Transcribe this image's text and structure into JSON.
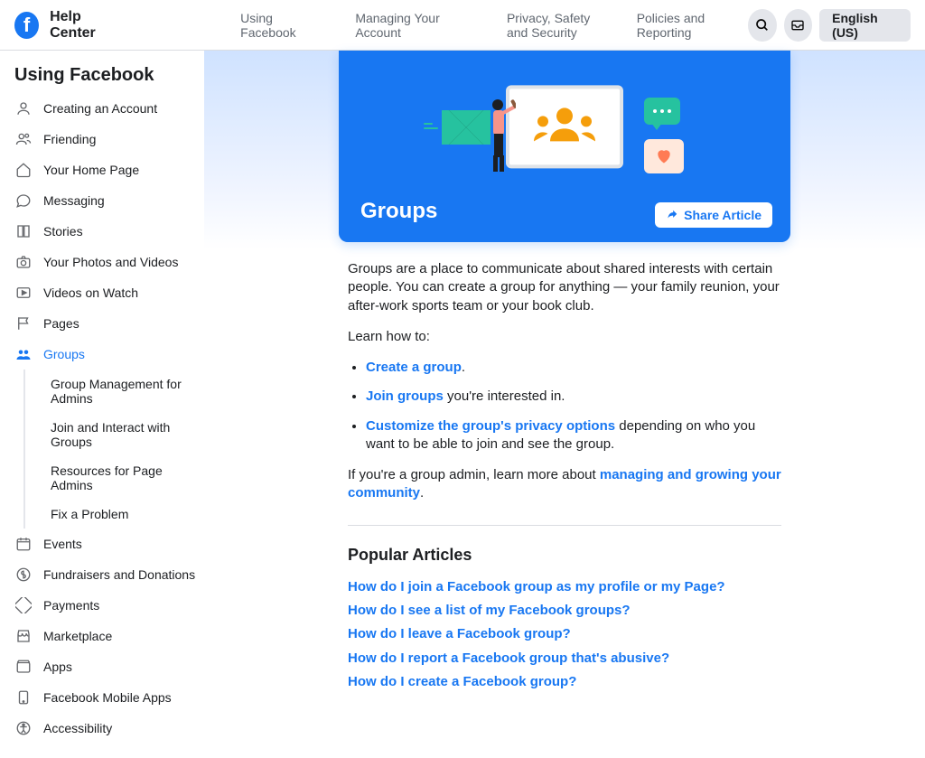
{
  "header": {
    "logo_letter": "f",
    "title": "Help Center",
    "nav": [
      "Using Facebook",
      "Managing Your Account",
      "Privacy, Safety and Security",
      "Policies and Reporting"
    ],
    "language": "English (US)"
  },
  "sidebar": {
    "title": "Using Facebook",
    "items": [
      {
        "label": "Creating an Account",
        "icon": "user"
      },
      {
        "label": "Friending",
        "icon": "friend"
      },
      {
        "label": "Your Home Page",
        "icon": "home"
      },
      {
        "label": "Messaging",
        "icon": "chat"
      },
      {
        "label": "Stories",
        "icon": "book"
      },
      {
        "label": "Your Photos and Videos",
        "icon": "camera"
      },
      {
        "label": "Videos on Watch",
        "icon": "play"
      },
      {
        "label": "Pages",
        "icon": "flag"
      },
      {
        "label": "Groups",
        "icon": "groups",
        "active": true,
        "children": [
          {
            "label": "Group Management for Admins"
          },
          {
            "label": "Join and Interact with Groups"
          },
          {
            "label": "Resources for Page Admins"
          },
          {
            "label": "Fix a Problem"
          }
        ]
      },
      {
        "label": "Events",
        "icon": "calendar"
      },
      {
        "label": "Fundraisers and Donations",
        "icon": "donate"
      },
      {
        "label": "Payments",
        "icon": "payments"
      },
      {
        "label": "Marketplace",
        "icon": "store"
      },
      {
        "label": "Apps",
        "icon": "apps"
      },
      {
        "label": "Facebook Mobile Apps",
        "icon": "mobile"
      },
      {
        "label": "Accessibility",
        "icon": "access"
      }
    ]
  },
  "hero": {
    "title": "Groups",
    "share_label": "Share Article"
  },
  "content": {
    "intro": "Groups are a place to communicate about shared interests with certain people. You can create a group for anything — your family reunion, your after-work sports team or your book club.",
    "learn_how": "Learn how to:",
    "bullets": [
      {
        "link": "Create a group",
        "after": "."
      },
      {
        "link": "Join groups",
        "after": " you're interested in."
      },
      {
        "link": "Customize the group's privacy options",
        "after": " depending on who you want to be able to join and see the group."
      }
    ],
    "admin_prefix": "If you're a group admin, learn more about ",
    "admin_link": "managing and growing your community",
    "admin_suffix": "."
  },
  "popular": {
    "title": "Popular Articles",
    "links": [
      "How do I join a Facebook group as my profile or my Page?",
      "How do I see a list of my Facebook groups?",
      "How do I leave a Facebook group?",
      "How do I report a Facebook group that's abusive?",
      "How do I create a Facebook group?"
    ]
  }
}
